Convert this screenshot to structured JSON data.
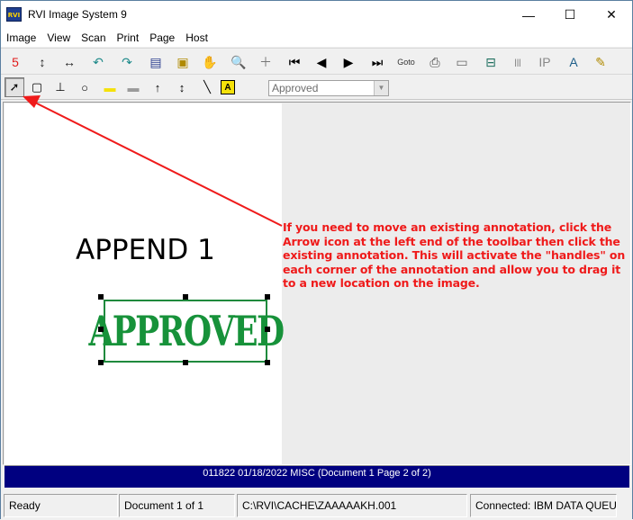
{
  "window": {
    "title": "RVI Image System 9",
    "logo_text": "RVI",
    "minimize_glyph": "—",
    "maximize_glyph": "☐",
    "close_glyph": "✕"
  },
  "menu": [
    "Image",
    "View",
    "Scan",
    "Print",
    "Page",
    "Host"
  ],
  "toolbar1": [
    {
      "icon": "red-s-icon",
      "glyph": "5",
      "color": "#e01b1b"
    },
    {
      "icon": "vertical-arrows-icon",
      "glyph": "↕",
      "color": "#222222"
    },
    {
      "icon": "horizontal-arrows-icon",
      "glyph": "↔",
      "color": "#222222"
    },
    {
      "icon": "rotate-left-icon",
      "glyph": "↶",
      "color": "#1f8a8a"
    },
    {
      "icon": "rotate-right-icon",
      "glyph": "↷",
      "color": "#1f8a8a"
    },
    {
      "icon": "thumbnails-icon",
      "glyph": "▤",
      "color": "#2c3f8f"
    },
    {
      "icon": "select-area-icon",
      "glyph": "▣",
      "color": "#b08a00"
    },
    {
      "icon": "hand-pan-icon",
      "glyph": "✋",
      "color": "#333333"
    },
    {
      "icon": "zoom-icon",
      "glyph": "🔍",
      "color": "#333333"
    },
    {
      "icon": "crosshair-icon",
      "glyph": "＋",
      "color": "#777777"
    },
    {
      "icon": "first-page-icon",
      "glyph": "⏮",
      "color": "#000000"
    },
    {
      "icon": "previous-page-icon",
      "glyph": "◀",
      "color": "#000000"
    },
    {
      "icon": "next-page-icon",
      "glyph": "▶",
      "color": "#000000"
    },
    {
      "icon": "last-page-icon",
      "glyph": "⏭",
      "color": "#000000"
    },
    {
      "icon": "goto-page-icon",
      "glyph": "Goto",
      "color": "#333333"
    },
    {
      "icon": "print-icon",
      "glyph": "⎙",
      "color": "#444444"
    },
    {
      "icon": "fax-icon",
      "glyph": "▭",
      "color": "#666666"
    },
    {
      "icon": "scanner-icon",
      "glyph": "⊟",
      "color": "#1f6f5f"
    },
    {
      "icon": "barcode-icon",
      "glyph": "|||",
      "color": "#666666"
    },
    {
      "icon": "ip-icon",
      "glyph": "IP",
      "color": "#888888"
    },
    {
      "icon": "font-icon",
      "glyph": "A",
      "color": "#1f5f8a"
    },
    {
      "icon": "wand-icon",
      "glyph": "✎",
      "color": "#b08a00"
    }
  ],
  "toolbar2": [
    {
      "icon": "arrow-select-icon",
      "glyph": "➚"
    },
    {
      "icon": "rounded-rect-icon",
      "glyph": "▢"
    },
    {
      "icon": "stamp-icon",
      "glyph": "⊥"
    },
    {
      "icon": "ellipse-icon",
      "glyph": "○"
    },
    {
      "icon": "highlighter-icon",
      "glyph": "▬"
    },
    {
      "icon": "redact-icon",
      "glyph": "▬"
    },
    {
      "icon": "arrow-up-line-icon",
      "glyph": "↑"
    },
    {
      "icon": "double-arrow-line-icon",
      "glyph": "↕"
    },
    {
      "icon": "line-icon",
      "glyph": "╲"
    },
    {
      "icon": "text-note-icon",
      "glyph": "A"
    }
  ],
  "stamp_select": {
    "value": "Approved"
  },
  "document": {
    "text": "APPEND 1",
    "stamp": "APPROVED"
  },
  "annotation_note": "If you need to move an existing annotation, click the Arrow icon at the left end of the toolbar then click the existing annotation. This will activate the \"handles\" on each corner of the annotation and allow you to drag it to a new location on the image.",
  "info_bar": "011822 01/18/2022 MISC (Document 1 Page 2 of 2)",
  "status": {
    "state": "Ready",
    "document": "Document 1 of 1",
    "path": "C:\\RVI\\CACHE\\ZAAAAAKH.001",
    "connection": "Connected: IBM DATA QUEUES"
  },
  "colors": {
    "accent_red": "#ef1a1a",
    "stamp_green": "#17923a",
    "info_bar_bg": "#000080"
  }
}
